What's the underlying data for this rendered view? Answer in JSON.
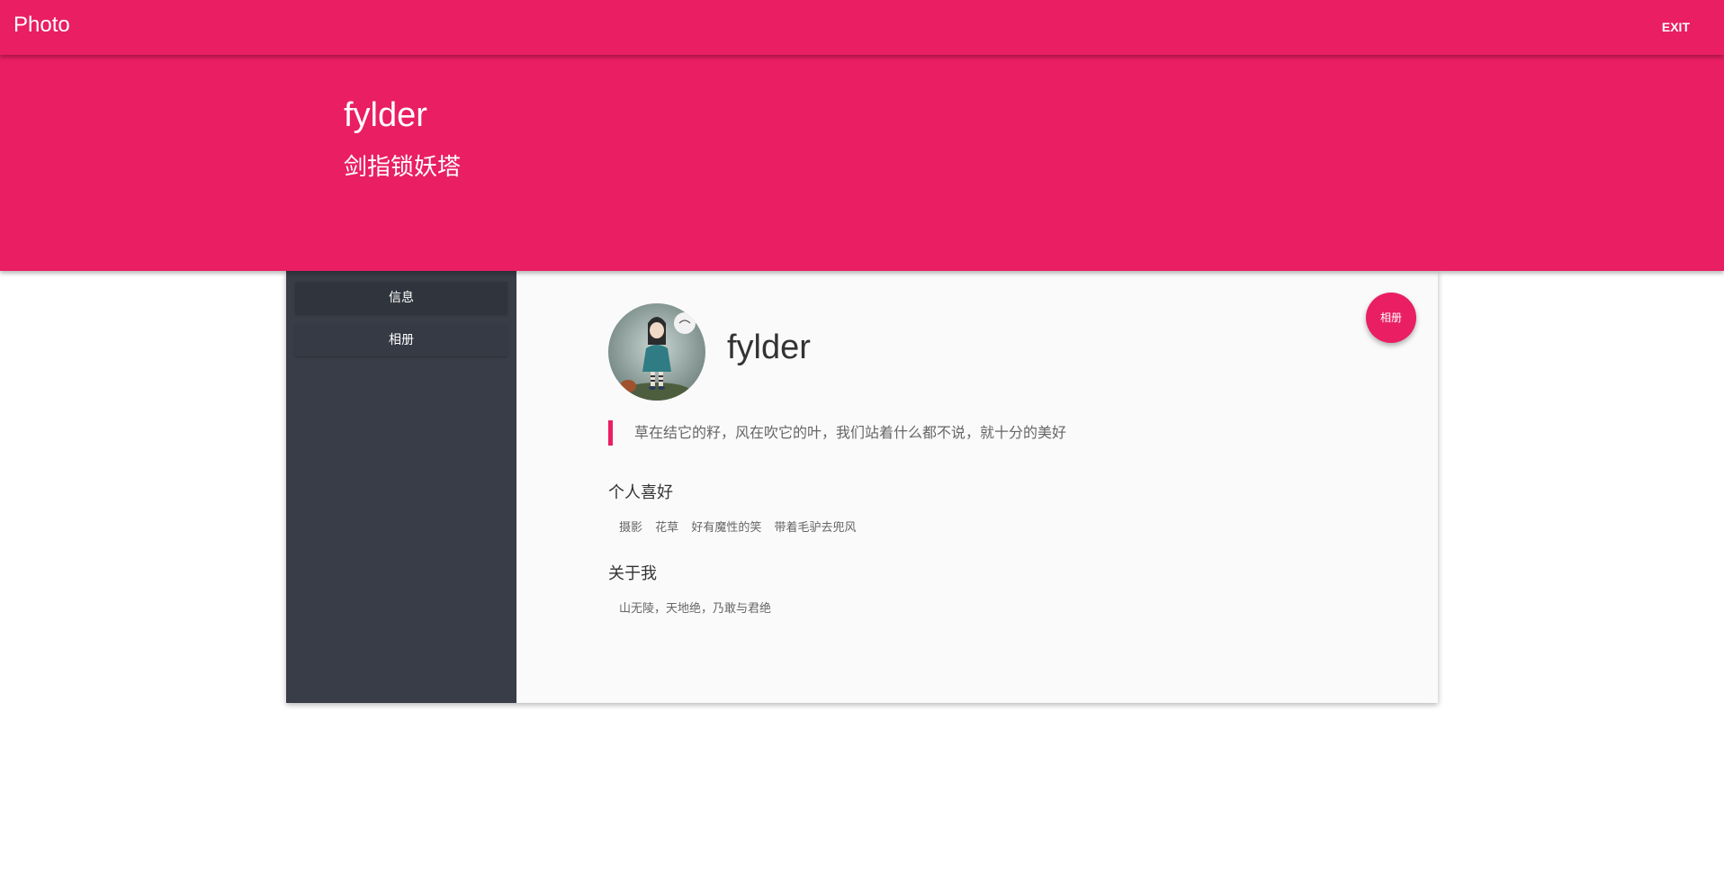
{
  "appbar": {
    "title": "Photo",
    "exit_label": "EXIT",
    "color": "#e91e63"
  },
  "hero": {
    "name": "fylder",
    "subtitle": "剑指锁妖塔"
  },
  "sidebar": {
    "items": [
      {
        "label": "信息"
      },
      {
        "label": "相册"
      }
    ]
  },
  "profile": {
    "avatar_icon": "avatar-girl-illustration",
    "name": "fylder",
    "album_button": "相册",
    "quote": "草在结它的籽，风在吹它的叶，我们站着什么都不说，就十分的美好",
    "hobbies_title": "个人喜好",
    "hobbies": [
      "摄影",
      "花草",
      "好有魔性的笑",
      "带着毛驴去兜风"
    ],
    "about_title": "关于我",
    "about_text": "山无陵，天地绝，乃敢与君绝"
  }
}
